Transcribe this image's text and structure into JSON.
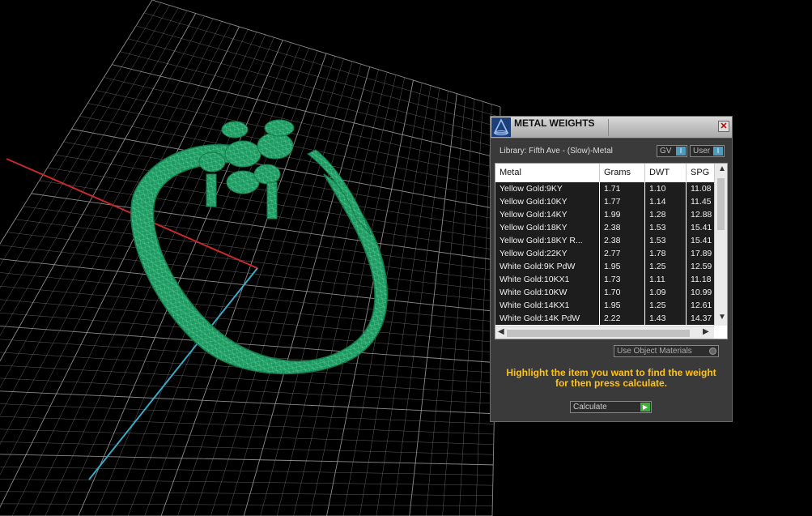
{
  "viewport": {
    "grid_color": "#9a9a9a",
    "model_color": "#1f9a63",
    "x_axis_color": "#c62a2a",
    "y_axis_color": "#3aa9c7"
  },
  "panel": {
    "title": "METAL WEIGHTS",
    "close_glyph": "✕",
    "library_label": "Library: Fifth Ave - (Slow)-Metal",
    "gv_label": "GV",
    "user_label": "User",
    "toggle_glyph": "I",
    "columns": [
      "Metal",
      "Grams",
      "DWT",
      "SPG"
    ],
    "rows": [
      [
        "Yellow Gold:9KY",
        "1.71",
        "1.10",
        "11.08"
      ],
      [
        "Yellow Gold:10KY",
        "1.77",
        "1.14",
        "11.45"
      ],
      [
        "Yellow Gold:14KY",
        "1.99",
        "1.28",
        "12.88"
      ],
      [
        "Yellow Gold:18KY",
        "2.38",
        "1.53",
        "15.41"
      ],
      [
        "Yellow Gold:18KY R...",
        "2.38",
        "1.53",
        "15.41"
      ],
      [
        "Yellow Gold:22KY",
        "2.77",
        "1.78",
        "17.89"
      ],
      [
        "White Gold:9K PdW",
        "1.95",
        "1.25",
        "12.59"
      ],
      [
        "White Gold:10KX1",
        "1.73",
        "1.11",
        "11.18"
      ],
      [
        "White Gold:10KW",
        "1.70",
        "1.09",
        "10.99"
      ],
      [
        "White Gold:14KX1",
        "1.95",
        "1.25",
        "12.61"
      ],
      [
        "White Gold:14K PdW",
        "2.22",
        "1.43",
        "14.37"
      ]
    ],
    "use_object_materials": "Use Object Materials",
    "instruction": "Highlight the item you want to find the weight for then press calculate.",
    "calculate_label": "Calculate",
    "accent_color": "#ffc21a"
  }
}
